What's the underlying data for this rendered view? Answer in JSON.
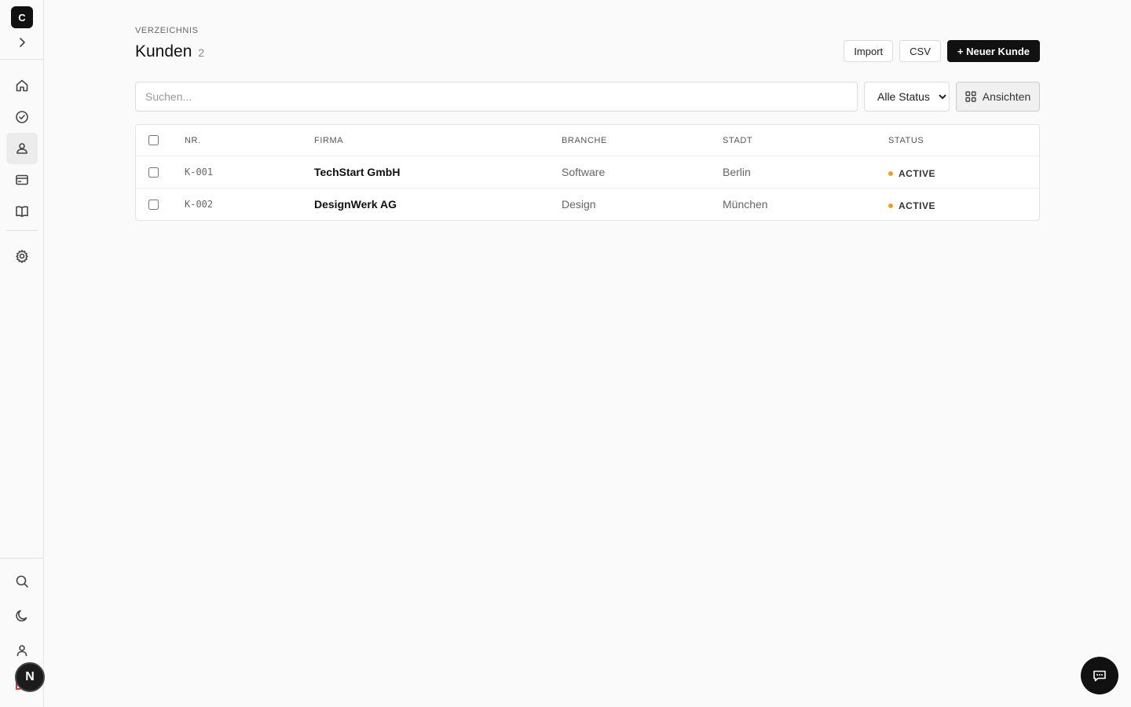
{
  "sidebar": {
    "logo_letter": "C",
    "expand_icon": "chevron-right-icon",
    "nav": [
      {
        "icon": "home-icon",
        "active": false
      },
      {
        "icon": "check-circle-icon",
        "active": false
      },
      {
        "icon": "users-icon",
        "active": true
      },
      {
        "icon": "credit-card-icon",
        "active": false
      },
      {
        "icon": "book-icon",
        "active": false
      },
      {
        "icon": "gear-icon",
        "active": false
      }
    ],
    "bottom": [
      {
        "icon": "search-icon"
      },
      {
        "icon": "moon-icon"
      },
      {
        "icon": "user-icon"
      }
    ],
    "avatar_letter": "N"
  },
  "header": {
    "eyebrow": "VERZEICHNIS",
    "title": "Kunden",
    "count": "2",
    "import_label": "Import",
    "csv_label": "CSV",
    "new_label": "+ Neuer Kunde"
  },
  "filters": {
    "search_placeholder": "Suchen...",
    "status_selected": "Alle Status",
    "views_label": "Ansichten"
  },
  "table": {
    "columns": [
      "NR.",
      "FIRMA",
      "BRANCHE",
      "STADT",
      "STATUS"
    ],
    "rows": [
      {
        "nr": "K-001",
        "firma": "TechStart GmbH",
        "branche": "Software",
        "stadt": "Berlin",
        "status": "ACTIVE"
      },
      {
        "nr": "K-002",
        "firma": "DesignWerk AG",
        "branche": "Design",
        "stadt": "München",
        "status": "ACTIVE"
      }
    ]
  },
  "colors": {
    "accent": "#111111",
    "status_active": "#f0a020",
    "background": "#fafafa"
  }
}
